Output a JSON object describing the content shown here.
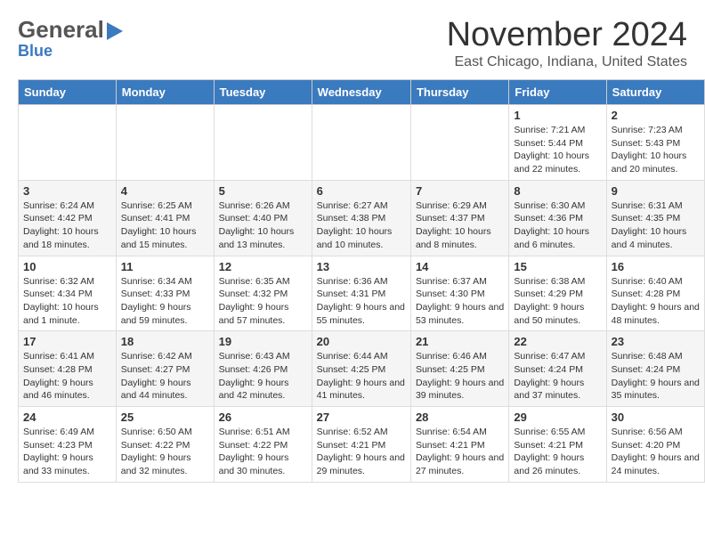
{
  "header": {
    "logo_general": "General",
    "logo_blue": "Blue",
    "title": "November 2024",
    "subtitle": "East Chicago, Indiana, United States"
  },
  "weekdays": [
    "Sunday",
    "Monday",
    "Tuesday",
    "Wednesday",
    "Thursday",
    "Friday",
    "Saturday"
  ],
  "weeks": [
    [
      {
        "day": "",
        "info": ""
      },
      {
        "day": "",
        "info": ""
      },
      {
        "day": "",
        "info": ""
      },
      {
        "day": "",
        "info": ""
      },
      {
        "day": "",
        "info": ""
      },
      {
        "day": "1",
        "info": "Sunrise: 7:21 AM\nSunset: 5:44 PM\nDaylight: 10 hours and 22 minutes."
      },
      {
        "day": "2",
        "info": "Sunrise: 7:23 AM\nSunset: 5:43 PM\nDaylight: 10 hours and 20 minutes."
      }
    ],
    [
      {
        "day": "3",
        "info": "Sunrise: 6:24 AM\nSunset: 4:42 PM\nDaylight: 10 hours and 18 minutes."
      },
      {
        "day": "4",
        "info": "Sunrise: 6:25 AM\nSunset: 4:41 PM\nDaylight: 10 hours and 15 minutes."
      },
      {
        "day": "5",
        "info": "Sunrise: 6:26 AM\nSunset: 4:40 PM\nDaylight: 10 hours and 13 minutes."
      },
      {
        "day": "6",
        "info": "Sunrise: 6:27 AM\nSunset: 4:38 PM\nDaylight: 10 hours and 10 minutes."
      },
      {
        "day": "7",
        "info": "Sunrise: 6:29 AM\nSunset: 4:37 PM\nDaylight: 10 hours and 8 minutes."
      },
      {
        "day": "8",
        "info": "Sunrise: 6:30 AM\nSunset: 4:36 PM\nDaylight: 10 hours and 6 minutes."
      },
      {
        "day": "9",
        "info": "Sunrise: 6:31 AM\nSunset: 4:35 PM\nDaylight: 10 hours and 4 minutes."
      }
    ],
    [
      {
        "day": "10",
        "info": "Sunrise: 6:32 AM\nSunset: 4:34 PM\nDaylight: 10 hours and 1 minute."
      },
      {
        "day": "11",
        "info": "Sunrise: 6:34 AM\nSunset: 4:33 PM\nDaylight: 9 hours and 59 minutes."
      },
      {
        "day": "12",
        "info": "Sunrise: 6:35 AM\nSunset: 4:32 PM\nDaylight: 9 hours and 57 minutes."
      },
      {
        "day": "13",
        "info": "Sunrise: 6:36 AM\nSunset: 4:31 PM\nDaylight: 9 hours and 55 minutes."
      },
      {
        "day": "14",
        "info": "Sunrise: 6:37 AM\nSunset: 4:30 PM\nDaylight: 9 hours and 53 minutes."
      },
      {
        "day": "15",
        "info": "Sunrise: 6:38 AM\nSunset: 4:29 PM\nDaylight: 9 hours and 50 minutes."
      },
      {
        "day": "16",
        "info": "Sunrise: 6:40 AM\nSunset: 4:28 PM\nDaylight: 9 hours and 48 minutes."
      }
    ],
    [
      {
        "day": "17",
        "info": "Sunrise: 6:41 AM\nSunset: 4:28 PM\nDaylight: 9 hours and 46 minutes."
      },
      {
        "day": "18",
        "info": "Sunrise: 6:42 AM\nSunset: 4:27 PM\nDaylight: 9 hours and 44 minutes."
      },
      {
        "day": "19",
        "info": "Sunrise: 6:43 AM\nSunset: 4:26 PM\nDaylight: 9 hours and 42 minutes."
      },
      {
        "day": "20",
        "info": "Sunrise: 6:44 AM\nSunset: 4:25 PM\nDaylight: 9 hours and 41 minutes."
      },
      {
        "day": "21",
        "info": "Sunrise: 6:46 AM\nSunset: 4:25 PM\nDaylight: 9 hours and 39 minutes."
      },
      {
        "day": "22",
        "info": "Sunrise: 6:47 AM\nSunset: 4:24 PM\nDaylight: 9 hours and 37 minutes."
      },
      {
        "day": "23",
        "info": "Sunrise: 6:48 AM\nSunset: 4:24 PM\nDaylight: 9 hours and 35 minutes."
      }
    ],
    [
      {
        "day": "24",
        "info": "Sunrise: 6:49 AM\nSunset: 4:23 PM\nDaylight: 9 hours and 33 minutes."
      },
      {
        "day": "25",
        "info": "Sunrise: 6:50 AM\nSunset: 4:22 PM\nDaylight: 9 hours and 32 minutes."
      },
      {
        "day": "26",
        "info": "Sunrise: 6:51 AM\nSunset: 4:22 PM\nDaylight: 9 hours and 30 minutes."
      },
      {
        "day": "27",
        "info": "Sunrise: 6:52 AM\nSunset: 4:21 PM\nDaylight: 9 hours and 29 minutes."
      },
      {
        "day": "28",
        "info": "Sunrise: 6:54 AM\nSunset: 4:21 PM\nDaylight: 9 hours and 27 minutes."
      },
      {
        "day": "29",
        "info": "Sunrise: 6:55 AM\nSunset: 4:21 PM\nDaylight: 9 hours and 26 minutes."
      },
      {
        "day": "30",
        "info": "Sunrise: 6:56 AM\nSunset: 4:20 PM\nDaylight: 9 hours and 24 minutes."
      }
    ]
  ]
}
